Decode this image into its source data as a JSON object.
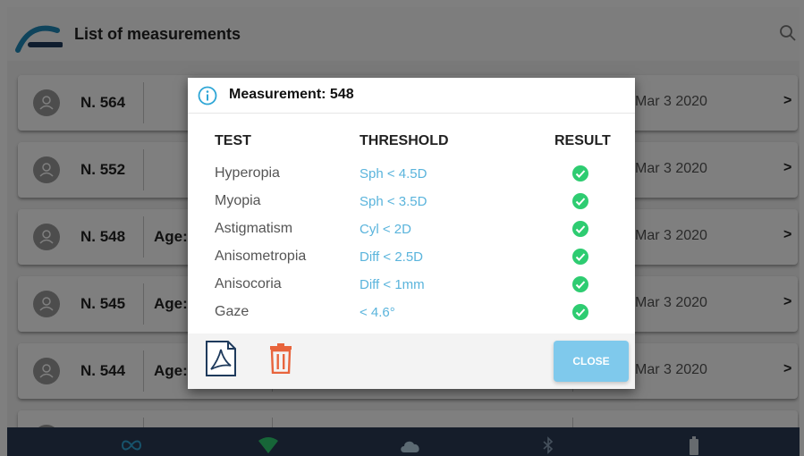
{
  "app": {
    "title": "List of measurements",
    "rows": [
      {
        "number": "N. 564",
        "age": "",
        "date": "Mar 3 2020"
      },
      {
        "number": "N. 552",
        "age": "",
        "date": "Mar 3 2020"
      },
      {
        "number": "N. 548",
        "age": "Age:",
        "date": "Mar 3 2020"
      },
      {
        "number": "N. 545",
        "age": "Age:",
        "date": "Mar 3 2020"
      },
      {
        "number": "N. 544",
        "age": "Age:",
        "date": "Mar 3 2020"
      }
    ],
    "row_chevron": ">"
  },
  "dialog": {
    "title": "Measurement: 548",
    "headers": {
      "test": "TEST",
      "threshold": "THRESHOLD",
      "result": "RESULT"
    },
    "tests": [
      {
        "test": "Hyperopia",
        "threshold": "Sph < 4.5D",
        "result": "pass"
      },
      {
        "test": "Myopia",
        "threshold": "Sph < 3.5D",
        "result": "pass"
      },
      {
        "test": "Astigmatism",
        "threshold": "Cyl < 2D",
        "result": "pass"
      },
      {
        "test": "Anisometropia",
        "threshold": "Diff < 2.5D",
        "result": "pass"
      },
      {
        "test": "Anisocoria",
        "threshold": "Diff < 1mm",
        "result": "pass"
      },
      {
        "test": "Gaze",
        "threshold": "< 4.6°",
        "result": "pass"
      }
    ],
    "close_label": "CLOSE"
  },
  "icons": {
    "logo": "app-logo",
    "search": "search-icon",
    "info": "info-icon",
    "pdf": "pdf-icon",
    "trash": "trash-icon",
    "check": "check-circle-icon",
    "bottom": [
      "infinity-icon",
      "wifi-icon",
      "cloud-icon",
      "bluetooth-icon",
      "battery-icon"
    ]
  },
  "colors": {
    "accent": "#5ab4dc",
    "close_button": "#7fc9ec",
    "check": "#2ecc71",
    "trash": "#e8643c",
    "bottom_bar": "#2a3a55"
  }
}
